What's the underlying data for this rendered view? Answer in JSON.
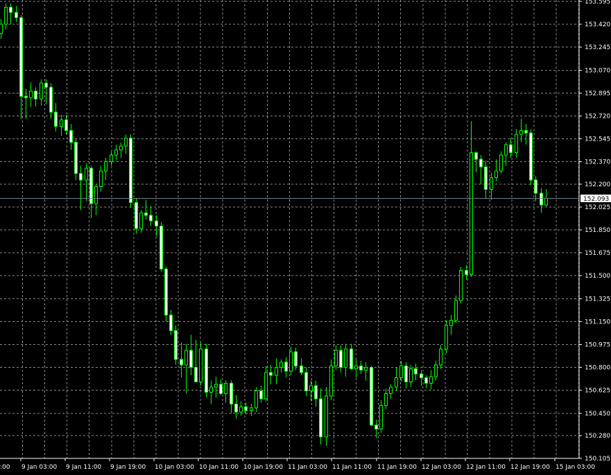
{
  "chart_data": {
    "type": "candlestick",
    "colors": {
      "background": "#000000",
      "grid": "#8c8c8c",
      "axis": "#ffffff",
      "bull_fill": "#000000",
      "bull_stroke": "#00ff00",
      "bear_fill": "#ffffff",
      "wick": "#00ff00",
      "current_line": "#708090",
      "label_text": "#ffffff"
    },
    "grid": true,
    "ylim": [
      150.105,
      153.595
    ],
    "yticks": [
      "153.595",
      "153.420",
      "153.245",
      "153.070",
      "152.895",
      "152.720",
      "152.545",
      "152.370",
      "152.200",
      "152.025",
      "151.850",
      "151.675",
      "151.500",
      "151.325",
      "151.150",
      "150.975",
      "150.800",
      "150.625",
      "150.450",
      "150.280",
      "150.105"
    ],
    "current_price": "152.093",
    "xticks": [
      ":00",
      "9 Jan 03:00",
      "9 Jan 11:00",
      "9 Jan 19:00",
      "10 Jan 03:00",
      "10 Jan 11:00",
      "10 Jan 19:00",
      "11 Jan 03:00",
      "11 Jan 11:00",
      "11 Jan 19:00",
      "12 Jan 03:00",
      "12 Jan 11:00",
      "12 Jan 19:00",
      "15 Jan 03:00"
    ],
    "candles": [
      [
        153.35,
        153.46,
        153.31,
        153.42
      ],
      [
        153.42,
        153.58,
        153.38,
        153.55
      ],
      [
        153.55,
        153.58,
        153.42,
        153.51
      ],
      [
        153.51,
        153.56,
        153.44,
        153.47
      ],
      [
        153.47,
        153.49,
        152.7,
        152.87
      ],
      [
        152.87,
        152.93,
        152.7,
        152.86
      ],
      [
        152.86,
        152.98,
        152.79,
        152.91
      ],
      [
        152.91,
        152.94,
        152.79,
        152.85
      ],
      [
        152.85,
        153.0,
        152.8,
        152.97
      ],
      [
        152.97,
        153.0,
        152.81,
        152.94
      ],
      [
        152.94,
        152.97,
        152.7,
        152.75
      ],
      [
        152.75,
        152.82,
        152.6,
        152.64
      ],
      [
        152.64,
        152.73,
        152.57,
        152.69
      ],
      [
        152.69,
        152.73,
        152.58,
        152.61
      ],
      [
        152.61,
        152.66,
        152.46,
        152.52
      ],
      [
        152.52,
        152.54,
        152.23,
        152.28
      ],
      [
        152.28,
        152.34,
        152.0,
        152.23
      ],
      [
        152.23,
        152.36,
        152.07,
        152.32
      ],
      [
        152.32,
        152.34,
        151.94,
        152.05
      ],
      [
        152.05,
        152.2,
        151.96,
        152.18
      ],
      [
        152.18,
        152.34,
        152.14,
        152.3
      ],
      [
        152.3,
        152.4,
        152.23,
        152.37
      ],
      [
        152.37,
        152.45,
        152.34,
        152.42
      ],
      [
        152.42,
        152.5,
        152.38,
        152.46
      ],
      [
        152.46,
        152.52,
        152.4,
        152.49
      ],
      [
        152.49,
        152.58,
        152.43,
        152.55
      ],
      [
        152.55,
        152.58,
        152.02,
        152.06
      ],
      [
        152.06,
        152.09,
        151.82,
        151.86
      ],
      [
        151.86,
        152.0,
        151.83,
        151.98
      ],
      [
        151.98,
        152.08,
        151.93,
        151.96
      ],
      [
        151.96,
        152.03,
        151.88,
        151.92
      ],
      [
        151.92,
        151.96,
        151.8,
        151.88
      ],
      [
        151.88,
        151.91,
        151.53,
        151.55
      ],
      [
        151.55,
        151.57,
        151.15,
        151.2
      ],
      [
        151.2,
        151.24,
        151.05,
        151.08
      ],
      [
        151.08,
        151.12,
        150.82,
        150.86
      ],
      [
        150.86,
        150.99,
        150.72,
        150.82
      ],
      [
        150.82,
        150.98,
        150.6,
        150.93
      ],
      [
        150.93,
        151.05,
        150.74,
        150.8
      ],
      [
        150.8,
        151.01,
        150.7,
        150.69
      ],
      [
        150.69,
        150.99,
        150.66,
        150.94
      ],
      [
        150.94,
        150.98,
        150.57,
        150.61
      ],
      [
        150.61,
        150.7,
        150.52,
        150.65
      ],
      [
        150.65,
        150.73,
        150.57,
        150.67
      ],
      [
        150.67,
        150.71,
        150.59,
        150.6
      ],
      [
        150.6,
        150.7,
        150.53,
        150.68
      ],
      [
        150.68,
        150.7,
        150.45,
        150.52
      ],
      [
        150.52,
        150.59,
        150.41,
        150.46
      ],
      [
        150.46,
        150.54,
        150.43,
        150.5
      ],
      [
        150.5,
        150.53,
        150.44,
        150.47
      ],
      [
        150.47,
        150.52,
        150.43,
        150.49
      ],
      [
        150.49,
        150.65,
        150.46,
        150.62
      ],
      [
        150.62,
        150.66,
        150.53,
        150.56
      ],
      [
        150.56,
        150.81,
        150.54,
        150.76
      ],
      [
        150.76,
        150.82,
        150.67,
        150.74
      ],
      [
        150.74,
        150.87,
        150.67,
        150.8
      ],
      [
        150.8,
        150.86,
        150.76,
        150.84
      ],
      [
        150.84,
        150.88,
        150.72,
        150.77
      ],
      [
        150.77,
        150.96,
        150.74,
        150.92
      ],
      [
        150.92,
        150.95,
        150.78,
        150.81
      ],
      [
        150.81,
        150.87,
        150.74,
        150.76
      ],
      [
        150.76,
        150.8,
        150.58,
        150.62
      ],
      [
        150.62,
        150.7,
        150.54,
        150.66
      ],
      [
        150.66,
        150.7,
        150.5,
        150.56
      ],
      [
        150.56,
        150.64,
        150.21,
        150.27
      ],
      [
        150.27,
        150.65,
        150.2,
        150.58
      ],
      [
        150.58,
        150.86,
        150.55,
        150.81
      ],
      [
        150.81,
        150.97,
        150.78,
        150.93
      ],
      [
        150.93,
        150.97,
        150.76,
        150.8
      ],
      [
        150.8,
        150.98,
        150.73,
        150.94
      ],
      [
        150.94,
        150.98,
        150.78,
        150.79
      ],
      [
        150.79,
        150.86,
        150.72,
        150.81
      ],
      [
        150.81,
        150.85,
        150.75,
        150.78
      ],
      [
        150.78,
        150.84,
        150.7,
        150.8
      ],
      [
        150.8,
        150.81,
        150.35,
        150.36
      ],
      [
        150.36,
        150.4,
        150.26,
        150.33
      ],
      [
        150.33,
        150.55,
        150.3,
        150.51
      ],
      [
        150.51,
        150.64,
        150.48,
        150.6
      ],
      [
        150.6,
        150.67,
        150.56,
        150.65
      ],
      [
        150.65,
        150.8,
        150.62,
        150.72
      ],
      [
        150.72,
        150.85,
        150.69,
        150.81
      ],
      [
        150.81,
        150.84,
        150.64,
        150.69
      ],
      [
        150.69,
        150.82,
        150.65,
        150.79
      ],
      [
        150.79,
        150.83,
        150.7,
        150.75
      ],
      [
        150.75,
        150.78,
        150.66,
        150.72
      ],
      [
        150.72,
        150.74,
        150.64,
        150.68
      ],
      [
        150.68,
        150.78,
        150.63,
        150.73
      ],
      [
        150.73,
        150.85,
        150.7,
        150.82
      ],
      [
        150.82,
        150.97,
        150.79,
        150.94
      ],
      [
        150.94,
        151.16,
        150.91,
        151.12
      ],
      [
        151.12,
        151.2,
        151.05,
        151.16
      ],
      [
        151.16,
        151.35,
        151.14,
        151.31
      ],
      [
        151.31,
        151.57,
        151.29,
        151.54
      ],
      [
        151.54,
        151.58,
        151.47,
        151.51
      ],
      [
        151.51,
        152.68,
        151.49,
        152.44
      ],
      [
        152.44,
        152.45,
        152.29,
        152.39
      ],
      [
        152.39,
        152.42,
        152.2,
        152.33
      ],
      [
        152.33,
        152.38,
        152.09,
        152.16
      ],
      [
        152.16,
        152.29,
        152.08,
        152.25
      ],
      [
        152.25,
        152.39,
        152.22,
        152.3
      ],
      [
        152.3,
        152.45,
        152.28,
        152.42
      ],
      [
        152.42,
        152.52,
        152.34,
        152.5
      ],
      [
        152.5,
        152.55,
        152.4,
        152.44
      ],
      [
        152.44,
        152.62,
        152.4,
        152.58
      ],
      [
        152.58,
        152.7,
        152.52,
        152.61
      ],
      [
        152.61,
        152.66,
        152.5,
        152.59
      ],
      [
        152.59,
        152.62,
        152.19,
        152.23
      ],
      [
        152.23,
        152.26,
        152.07,
        152.13
      ],
      [
        152.13,
        152.17,
        151.98,
        152.04
      ],
      [
        152.04,
        152.16,
        152.03,
        152.09
      ]
    ]
  }
}
